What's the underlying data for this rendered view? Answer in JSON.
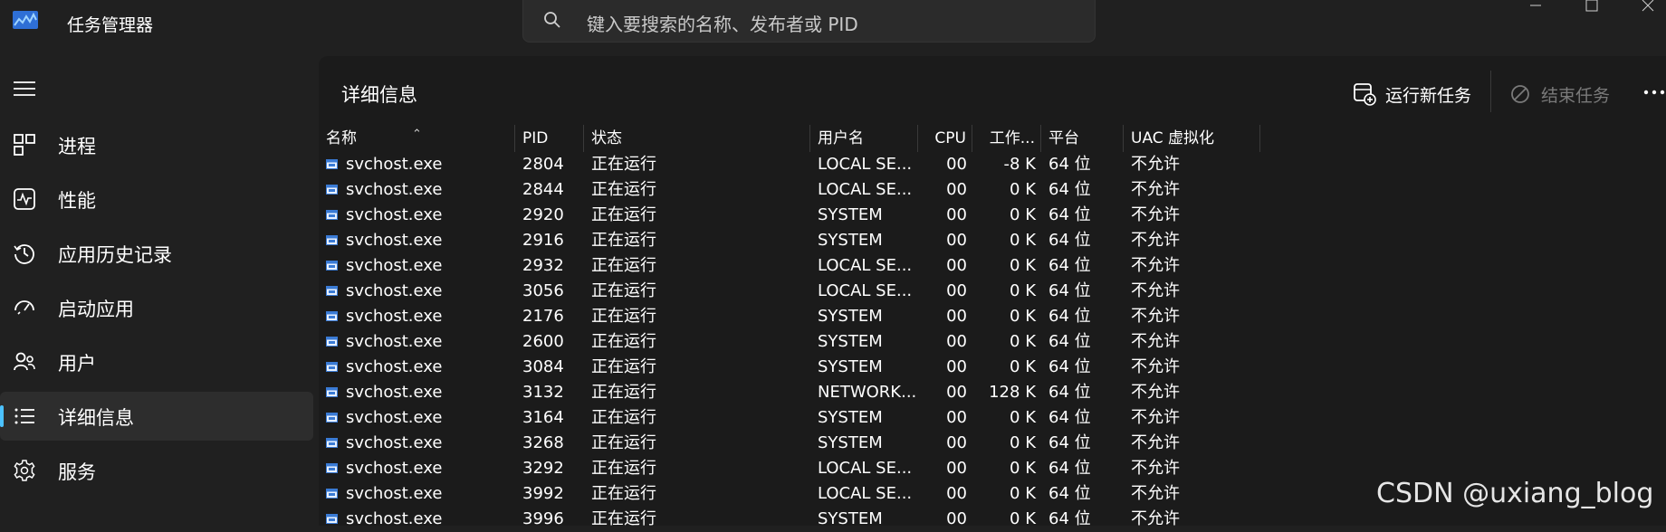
{
  "app": {
    "title": "任务管理器"
  },
  "search": {
    "placeholder": "键入要搜索的名称、发布者或 PID"
  },
  "window_controls": [
    "minimize-icon",
    "maximize-icon",
    "close-icon"
  ],
  "sidebar": {
    "items": [
      {
        "label": "进程",
        "icon": "processes-icon",
        "active": false
      },
      {
        "label": "性能",
        "icon": "performance-icon",
        "active": false
      },
      {
        "label": "应用历史记录",
        "icon": "history-icon",
        "active": false
      },
      {
        "label": "启动应用",
        "icon": "startup-icon",
        "active": false
      },
      {
        "label": "用户",
        "icon": "users-icon",
        "active": false
      },
      {
        "label": "详细信息",
        "icon": "details-icon",
        "active": true
      },
      {
        "label": "服务",
        "icon": "services-icon",
        "active": false
      }
    ]
  },
  "main": {
    "title": "详细信息",
    "run_task_label": "运行新任务",
    "end_task_label": "结束任务",
    "more_icon": "more-icon"
  },
  "table": {
    "columns": [
      "名称",
      "PID",
      "状态",
      "用户名",
      "CPU",
      "工作...",
      "平台",
      "UAC 虚拟化"
    ],
    "rows": [
      [
        "svchost.exe",
        "2804",
        "正在运行",
        "LOCAL SE...",
        "00",
        "-8 K",
        "64 位",
        "不允许"
      ],
      [
        "svchost.exe",
        "2844",
        "正在运行",
        "LOCAL SE...",
        "00",
        "0 K",
        "64 位",
        "不允许"
      ],
      [
        "svchost.exe",
        "2920",
        "正在运行",
        "SYSTEM",
        "00",
        "0 K",
        "64 位",
        "不允许"
      ],
      [
        "svchost.exe",
        "2916",
        "正在运行",
        "SYSTEM",
        "00",
        "0 K",
        "64 位",
        "不允许"
      ],
      [
        "svchost.exe",
        "2932",
        "正在运行",
        "LOCAL SE...",
        "00",
        "0 K",
        "64 位",
        "不允许"
      ],
      [
        "svchost.exe",
        "3056",
        "正在运行",
        "LOCAL SE...",
        "00",
        "0 K",
        "64 位",
        "不允许"
      ],
      [
        "svchost.exe",
        "2176",
        "正在运行",
        "SYSTEM",
        "00",
        "0 K",
        "64 位",
        "不允许"
      ],
      [
        "svchost.exe",
        "2600",
        "正在运行",
        "SYSTEM",
        "00",
        "0 K",
        "64 位",
        "不允许"
      ],
      [
        "svchost.exe",
        "3084",
        "正在运行",
        "SYSTEM",
        "00",
        "0 K",
        "64 位",
        "不允许"
      ],
      [
        "svchost.exe",
        "3132",
        "正在运行",
        "NETWORK...",
        "00",
        "128 K",
        "64 位",
        "不允许"
      ],
      [
        "svchost.exe",
        "3164",
        "正在运行",
        "SYSTEM",
        "00",
        "0 K",
        "64 位",
        "不允许"
      ],
      [
        "svchost.exe",
        "3268",
        "正在运行",
        "SYSTEM",
        "00",
        "0 K",
        "64 位",
        "不允许"
      ],
      [
        "svchost.exe",
        "3292",
        "正在运行",
        "LOCAL SE...",
        "00",
        "0 K",
        "64 位",
        "不允许"
      ],
      [
        "svchost.exe",
        "3992",
        "正在运行",
        "LOCAL SE...",
        "00",
        "0 K",
        "64 位",
        "不允许"
      ],
      [
        "svchost.exe",
        "3996",
        "正在运行",
        "SYSTEM",
        "00",
        "0 K",
        "64 位",
        "不允许"
      ]
    ]
  },
  "watermark": "CSDN @uxiang_blog",
  "colors": {
    "accent": "#4cc2ff",
    "background": "#202020",
    "panel": "#1b1b1b"
  }
}
